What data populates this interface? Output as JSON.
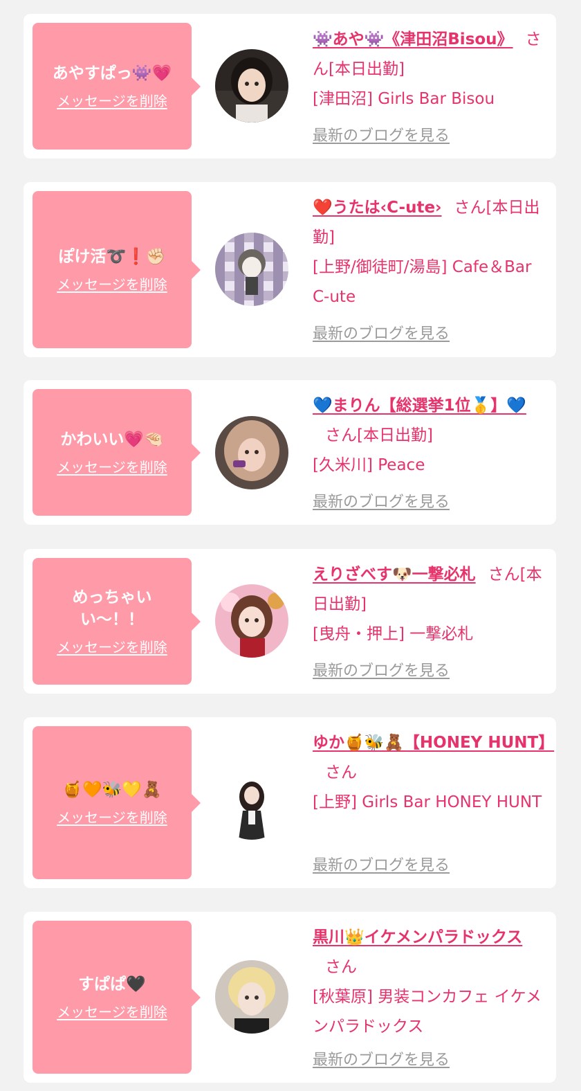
{
  "colors": {
    "background": "#f2f2f2",
    "card": "#ffffff",
    "bubble": "#ff9aa9",
    "name_text": "#e6336b",
    "blog_link": "#9a9a9a"
  },
  "entries": [
    {
      "message": "あやすぱっ👾💗",
      "delete_label": "メッセージを削除",
      "name": "👾あや👾《津田沼Bisou》",
      "suffix": "さん[本日出勤]",
      "shop": "[津田沼] Girls Bar Bisou",
      "blog_label": "最新のブログを見る"
    },
    {
      "message": "ぽけ活➰❗✊🏻",
      "delete_label": "メッセージを削除",
      "name": "❤️うたは‹C-ute›",
      "suffix": "さん[本日出勤]",
      "shop": "[上野/御徒町/湯島] Cafe＆Bar C-ute",
      "blog_label": "最新のブログを見る"
    },
    {
      "message": "かわいい💗🤏🏻",
      "delete_label": "メッセージを削除",
      "name": "💙まりん【総選挙1位🥇】💙",
      "suffix": "さん[本日出勤]",
      "shop": "[久米川] Peace",
      "blog_label": "最新のブログを見る"
    },
    {
      "message": "めっちゃいい〜！！",
      "delete_label": "メッセージを削除",
      "name": "えりざべす🐶一撃必札",
      "suffix": "さん[本日出勤]",
      "shop": "[曳舟・押上] 一撃必札",
      "blog_label": "最新のブログを見る"
    },
    {
      "message": "🍯🧡🐝💛🧸",
      "delete_label": "メッセージを削除",
      "name": "ゆか🍯🐝🧸【HONEY HUNT】",
      "suffix": "さん",
      "shop": "[上野] Girls Bar HONEY HUNT",
      "blog_label": "最新のブログを見る"
    },
    {
      "message": "すぱぱ🖤",
      "delete_label": "メッセージを削除",
      "name": "黒川👑イケメンパラドックス",
      "suffix": "さん",
      "shop": "[秋葉原] 男装コンカフェ イケメンパラドックス",
      "blog_label": "最新のブログを見る"
    }
  ]
}
